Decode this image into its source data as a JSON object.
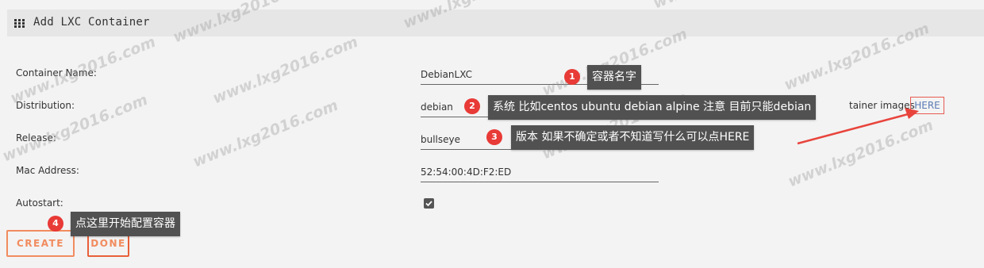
{
  "header": {
    "title": "Add LXC Container",
    "icon": "grid-icon"
  },
  "form": {
    "container_name": {
      "label": "Container Name:",
      "value": "DebianLXC"
    },
    "distribution": {
      "label": "Distribution:",
      "value": "debian",
      "hint_tail": "tainer images"
    },
    "release": {
      "label": "Release:",
      "value": "bullseye"
    },
    "mac_address": {
      "label": "Mac Address:",
      "value": "52:54:00:4D:F2:ED"
    },
    "autostart": {
      "label": "Autostart:",
      "checked": true
    },
    "here_link": "HERE"
  },
  "buttons": {
    "create": "CREATE",
    "done": "DONE"
  },
  "annotations": [
    {
      "num": "1",
      "text": "容器名字"
    },
    {
      "num": "2",
      "text": "系统 比如centos ubuntu  debian alpine 注意 目前只能debian"
    },
    {
      "num": "3",
      "text": "版本 如果不确定或者不知道写什么可以点HERE"
    },
    {
      "num": "4",
      "text": "点这里开始配置容器"
    }
  ],
  "watermark": "www.lxg2016.com",
  "colors": {
    "accent": "#f18c5f",
    "badge": "#e83a36",
    "tooltip": "#515151",
    "link": "#5b7bb5"
  }
}
